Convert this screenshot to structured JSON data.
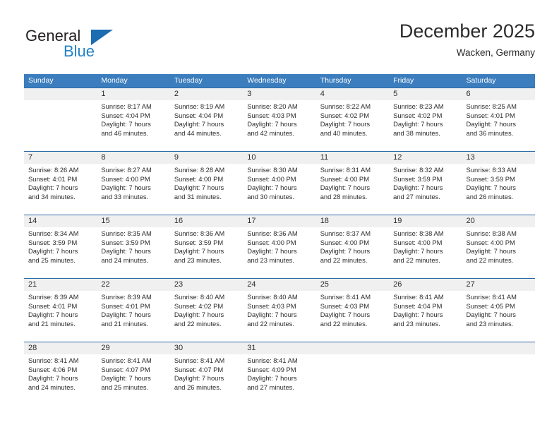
{
  "brand": {
    "name_top": "General",
    "name_bottom": "Blue",
    "triangle_color": "#1b6cb0",
    "blue_color": "#2281c4"
  },
  "header": {
    "title": "December 2025",
    "subtitle": "Wacken, Germany"
  },
  "colors": {
    "header_band": "#3b7dbd",
    "week_separator": "#2c6ca8",
    "date_band": "#f0f0f0"
  },
  "weekdays": [
    "Sunday",
    "Monday",
    "Tuesday",
    "Wednesday",
    "Thursday",
    "Friday",
    "Saturday"
  ],
  "weeks": [
    {
      "days": [
        {
          "date": "",
          "empty": true,
          "l1": "",
          "l2": "",
          "l3": "",
          "l4": ""
        },
        {
          "date": "1",
          "empty": false,
          "l1": "Sunrise: 8:17 AM",
          "l2": "Sunset: 4:04 PM",
          "l3": "Daylight: 7 hours",
          "l4": "and 46 minutes."
        },
        {
          "date": "2",
          "empty": false,
          "l1": "Sunrise: 8:19 AM",
          "l2": "Sunset: 4:04 PM",
          "l3": "Daylight: 7 hours",
          "l4": "and 44 minutes."
        },
        {
          "date": "3",
          "empty": false,
          "l1": "Sunrise: 8:20 AM",
          "l2": "Sunset: 4:03 PM",
          "l3": "Daylight: 7 hours",
          "l4": "and 42 minutes."
        },
        {
          "date": "4",
          "empty": false,
          "l1": "Sunrise: 8:22 AM",
          "l2": "Sunset: 4:02 PM",
          "l3": "Daylight: 7 hours",
          "l4": "and 40 minutes."
        },
        {
          "date": "5",
          "empty": false,
          "l1": "Sunrise: 8:23 AM",
          "l2": "Sunset: 4:02 PM",
          "l3": "Daylight: 7 hours",
          "l4": "and 38 minutes."
        },
        {
          "date": "6",
          "empty": false,
          "l1": "Sunrise: 8:25 AM",
          "l2": "Sunset: 4:01 PM",
          "l3": "Daylight: 7 hours",
          "l4": "and 36 minutes."
        }
      ]
    },
    {
      "days": [
        {
          "date": "7",
          "empty": false,
          "l1": "Sunrise: 8:26 AM",
          "l2": "Sunset: 4:01 PM",
          "l3": "Daylight: 7 hours",
          "l4": "and 34 minutes."
        },
        {
          "date": "8",
          "empty": false,
          "l1": "Sunrise: 8:27 AM",
          "l2": "Sunset: 4:00 PM",
          "l3": "Daylight: 7 hours",
          "l4": "and 33 minutes."
        },
        {
          "date": "9",
          "empty": false,
          "l1": "Sunrise: 8:28 AM",
          "l2": "Sunset: 4:00 PM",
          "l3": "Daylight: 7 hours",
          "l4": "and 31 minutes."
        },
        {
          "date": "10",
          "empty": false,
          "l1": "Sunrise: 8:30 AM",
          "l2": "Sunset: 4:00 PM",
          "l3": "Daylight: 7 hours",
          "l4": "and 30 minutes."
        },
        {
          "date": "11",
          "empty": false,
          "l1": "Sunrise: 8:31 AM",
          "l2": "Sunset: 4:00 PM",
          "l3": "Daylight: 7 hours",
          "l4": "and 28 minutes."
        },
        {
          "date": "12",
          "empty": false,
          "l1": "Sunrise: 8:32 AM",
          "l2": "Sunset: 3:59 PM",
          "l3": "Daylight: 7 hours",
          "l4": "and 27 minutes."
        },
        {
          "date": "13",
          "empty": false,
          "l1": "Sunrise: 8:33 AM",
          "l2": "Sunset: 3:59 PM",
          "l3": "Daylight: 7 hours",
          "l4": "and 26 minutes."
        }
      ]
    },
    {
      "days": [
        {
          "date": "14",
          "empty": false,
          "l1": "Sunrise: 8:34 AM",
          "l2": "Sunset: 3:59 PM",
          "l3": "Daylight: 7 hours",
          "l4": "and 25 minutes."
        },
        {
          "date": "15",
          "empty": false,
          "l1": "Sunrise: 8:35 AM",
          "l2": "Sunset: 3:59 PM",
          "l3": "Daylight: 7 hours",
          "l4": "and 24 minutes."
        },
        {
          "date": "16",
          "empty": false,
          "l1": "Sunrise: 8:36 AM",
          "l2": "Sunset: 3:59 PM",
          "l3": "Daylight: 7 hours",
          "l4": "and 23 minutes."
        },
        {
          "date": "17",
          "empty": false,
          "l1": "Sunrise: 8:36 AM",
          "l2": "Sunset: 4:00 PM",
          "l3": "Daylight: 7 hours",
          "l4": "and 23 minutes."
        },
        {
          "date": "18",
          "empty": false,
          "l1": "Sunrise: 8:37 AM",
          "l2": "Sunset: 4:00 PM",
          "l3": "Daylight: 7 hours",
          "l4": "and 22 minutes."
        },
        {
          "date": "19",
          "empty": false,
          "l1": "Sunrise: 8:38 AM",
          "l2": "Sunset: 4:00 PM",
          "l3": "Daylight: 7 hours",
          "l4": "and 22 minutes."
        },
        {
          "date": "20",
          "empty": false,
          "l1": "Sunrise: 8:38 AM",
          "l2": "Sunset: 4:00 PM",
          "l3": "Daylight: 7 hours",
          "l4": "and 22 minutes."
        }
      ]
    },
    {
      "days": [
        {
          "date": "21",
          "empty": false,
          "l1": "Sunrise: 8:39 AM",
          "l2": "Sunset: 4:01 PM",
          "l3": "Daylight: 7 hours",
          "l4": "and 21 minutes."
        },
        {
          "date": "22",
          "empty": false,
          "l1": "Sunrise: 8:39 AM",
          "l2": "Sunset: 4:01 PM",
          "l3": "Daylight: 7 hours",
          "l4": "and 21 minutes."
        },
        {
          "date": "23",
          "empty": false,
          "l1": "Sunrise: 8:40 AM",
          "l2": "Sunset: 4:02 PM",
          "l3": "Daylight: 7 hours",
          "l4": "and 22 minutes."
        },
        {
          "date": "24",
          "empty": false,
          "l1": "Sunrise: 8:40 AM",
          "l2": "Sunset: 4:03 PM",
          "l3": "Daylight: 7 hours",
          "l4": "and 22 minutes."
        },
        {
          "date": "25",
          "empty": false,
          "l1": "Sunrise: 8:41 AM",
          "l2": "Sunset: 4:03 PM",
          "l3": "Daylight: 7 hours",
          "l4": "and 22 minutes."
        },
        {
          "date": "26",
          "empty": false,
          "l1": "Sunrise: 8:41 AM",
          "l2": "Sunset: 4:04 PM",
          "l3": "Daylight: 7 hours",
          "l4": "and 23 minutes."
        },
        {
          "date": "27",
          "empty": false,
          "l1": "Sunrise: 8:41 AM",
          "l2": "Sunset: 4:05 PM",
          "l3": "Daylight: 7 hours",
          "l4": "and 23 minutes."
        }
      ]
    },
    {
      "days": [
        {
          "date": "28",
          "empty": false,
          "l1": "Sunrise: 8:41 AM",
          "l2": "Sunset: 4:06 PM",
          "l3": "Daylight: 7 hours",
          "l4": "and 24 minutes."
        },
        {
          "date": "29",
          "empty": false,
          "l1": "Sunrise: 8:41 AM",
          "l2": "Sunset: 4:07 PM",
          "l3": "Daylight: 7 hours",
          "l4": "and 25 minutes."
        },
        {
          "date": "30",
          "empty": false,
          "l1": "Sunrise: 8:41 AM",
          "l2": "Sunset: 4:07 PM",
          "l3": "Daylight: 7 hours",
          "l4": "and 26 minutes."
        },
        {
          "date": "31",
          "empty": false,
          "l1": "Sunrise: 8:41 AM",
          "l2": "Sunset: 4:09 PM",
          "l3": "Daylight: 7 hours",
          "l4": "and 27 minutes."
        },
        {
          "date": "",
          "empty": true,
          "l1": "",
          "l2": "",
          "l3": "",
          "l4": ""
        },
        {
          "date": "",
          "empty": true,
          "l1": "",
          "l2": "",
          "l3": "",
          "l4": ""
        },
        {
          "date": "",
          "empty": true,
          "l1": "",
          "l2": "",
          "l3": "",
          "l4": ""
        }
      ]
    }
  ]
}
